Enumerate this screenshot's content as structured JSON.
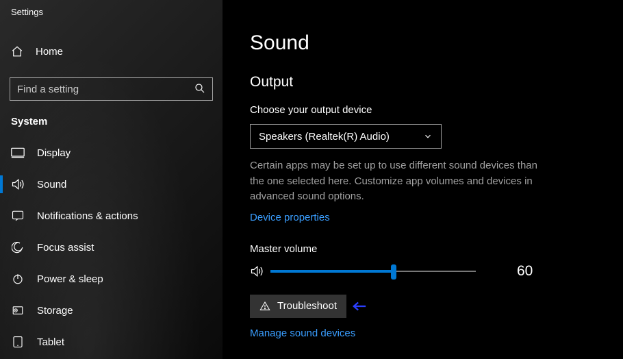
{
  "app_title": "Settings",
  "home_label": "Home",
  "search": {
    "placeholder": "Find a setting"
  },
  "section": "System",
  "nav": {
    "display": "Display",
    "sound": "Sound",
    "notifications": "Notifications & actions",
    "focus": "Focus assist",
    "power": "Power & sleep",
    "storage": "Storage",
    "tablet": "Tablet"
  },
  "page": {
    "title": "Sound",
    "output_section": "Output",
    "choose_label": "Choose your output device",
    "device_selected": "Speakers (Realtek(R) Audio)",
    "help_text": "Certain apps may be set up to use different sound devices than the one selected here. Customize app volumes and devices in advanced sound options.",
    "device_properties": "Device properties",
    "master_volume_label": "Master volume",
    "master_volume_value": "60",
    "troubleshoot": "Troubleshoot",
    "manage_devices": "Manage sound devices"
  }
}
